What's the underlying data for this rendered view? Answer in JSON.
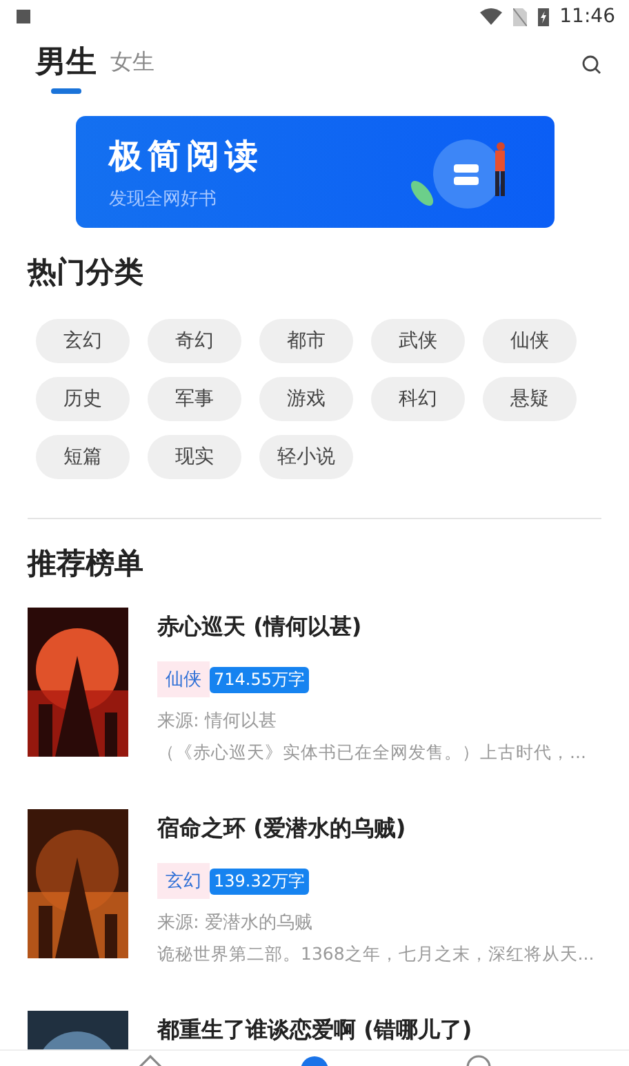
{
  "status_bar": {
    "time": "11:46"
  },
  "tabs": [
    {
      "label": "男生",
      "selected": true
    },
    {
      "label": "女生",
      "selected": false
    }
  ],
  "banner": {
    "title": "极简阅读",
    "subtitle": "发现全网好书"
  },
  "categories": {
    "title": "热门分类",
    "items": [
      "玄幻",
      "奇幻",
      "都市",
      "武侠",
      "仙侠",
      "历史",
      "军事",
      "游戏",
      "科幻",
      "悬疑",
      "短篇",
      "现实",
      "轻小说"
    ]
  },
  "rankings": {
    "title": "推荐榜单",
    "books": [
      {
        "title": "赤心巡天 (情何以甚)",
        "category": "仙侠",
        "words": "714.55万字",
        "source": "来源: 情何以甚",
        "intro": "（《赤心巡天》实体书已在全网发售。）上古时代，..."
      },
      {
        "title": "宿命之环 (爱潜水的乌贼)",
        "category": "玄幻",
        "words": "139.32万字",
        "source": "来源: 爱潜水的乌贼",
        "intro": "诡秘世界第二部。1368之年，七月之末，深红将从天..."
      },
      {
        "title": "都重生了谁谈恋爱啊 (错哪儿了)"
      }
    ]
  }
}
